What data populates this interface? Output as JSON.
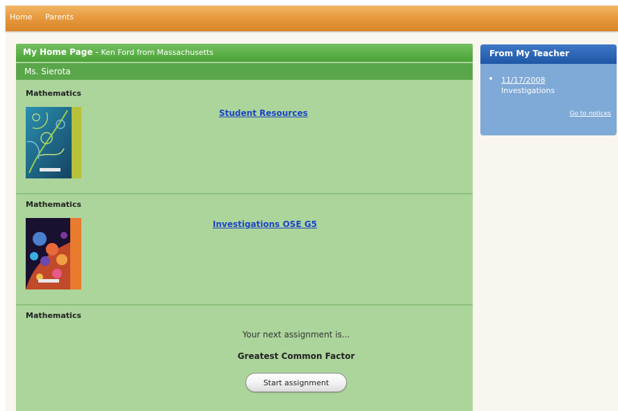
{
  "nav": {
    "items": [
      {
        "label": "Home"
      },
      {
        "label": "Parents"
      }
    ]
  },
  "main": {
    "title": "My Home Page",
    "separator": " - ",
    "student": "Ken Ford from Massachusetts",
    "teacher": "Ms. Sierota",
    "sections": [
      {
        "subject": "Mathematics",
        "link": "Student Resources",
        "cover": "fern-pattern-cover-icon"
      },
      {
        "subject": "Mathematics",
        "link": "Investigations OSE G5",
        "cover": "fractal-pattern-cover-icon"
      },
      {
        "subject": "Mathematics"
      }
    ],
    "next_assignment_text": "Your next assignment is...",
    "assignment_title": "Greatest Common Factor",
    "start_button": "Start assignment"
  },
  "side": {
    "title": "From My Teacher",
    "notice_date": "11/17/2008",
    "notice_text": "Investigations",
    "notices_link": "Go to notices"
  },
  "colors": {
    "nav_bar": "#e79a3e",
    "main_panel": "#acd59c",
    "main_header": "#4aa236",
    "side_panel": "#7fa9d6",
    "side_header": "#1e57a6",
    "link": "#1d43c8"
  }
}
